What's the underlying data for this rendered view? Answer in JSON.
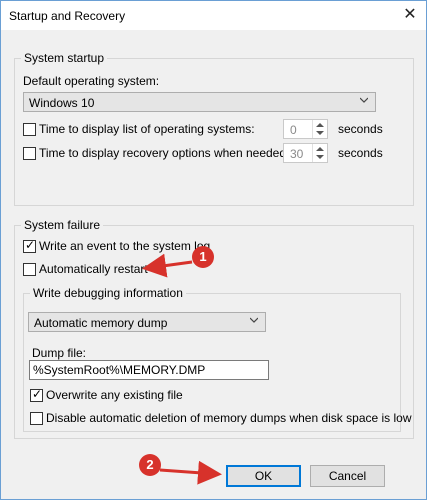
{
  "window": {
    "title": "Startup and Recovery",
    "close_icon": "close-icon"
  },
  "system_startup": {
    "group_label": "System startup",
    "default_os_label": "Default operating system:",
    "default_os_value": "Windows 10",
    "time_list": {
      "label": "Time to display list of operating systems:",
      "checked": false,
      "value": "0",
      "unit": "seconds"
    },
    "time_recovery": {
      "label": "Time to display recovery options when needed:",
      "checked": false,
      "value": "30",
      "unit": "seconds"
    }
  },
  "system_failure": {
    "group_label": "System failure",
    "write_event": {
      "label": "Write an event to the system log",
      "checked": true
    },
    "auto_restart": {
      "label": "Automatically restart",
      "checked": false
    },
    "debug_group_label": "Write debugging information",
    "debug_type_value": "Automatic memory dump",
    "dump_file_label": "Dump file:",
    "dump_file_value": "%SystemRoot%\\MEMORY.DMP",
    "overwrite": {
      "label": "Overwrite any existing file",
      "checked": true
    },
    "disable_auto_delete": {
      "label": "Disable automatic deletion of memory dumps when disk space is low",
      "checked": false
    }
  },
  "buttons": {
    "ok": "OK",
    "cancel": "Cancel"
  },
  "annotations": {
    "badge1": "1",
    "badge2": "2",
    "color": "#d7322b"
  },
  "checkmark_glyph": "✓"
}
